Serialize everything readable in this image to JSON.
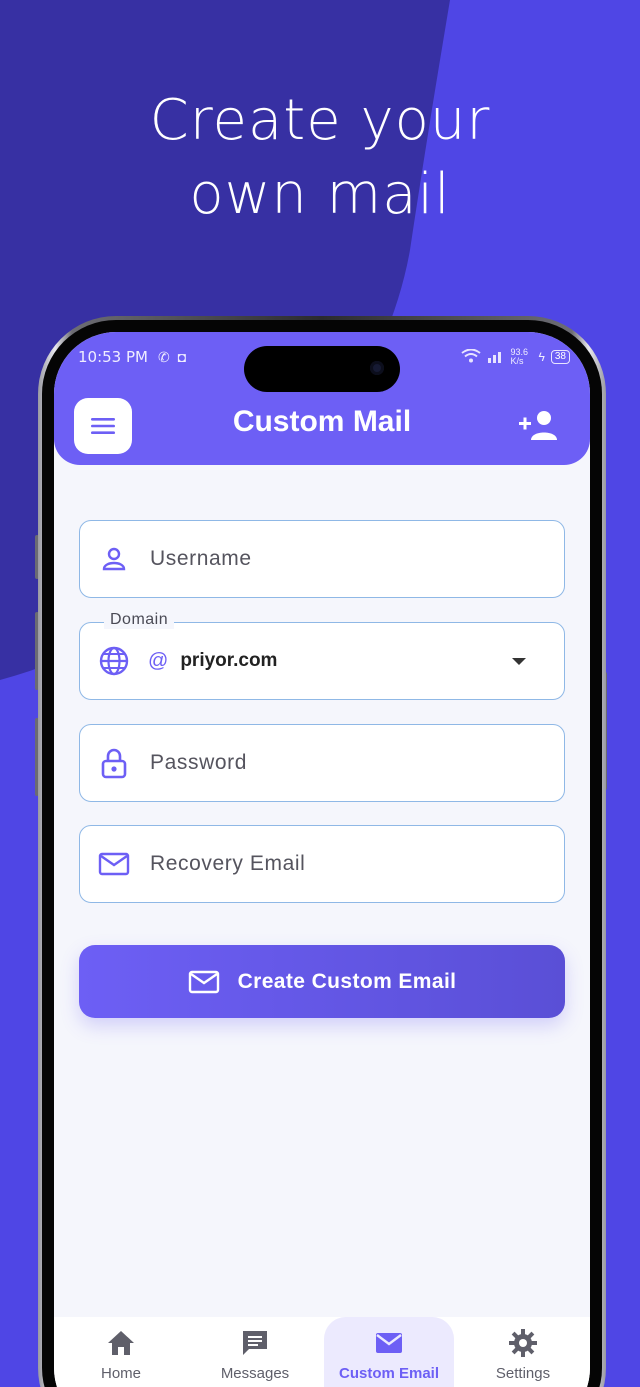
{
  "promo": {
    "line1": "Create your",
    "line2": "own mail"
  },
  "status_bar": {
    "time": "10:53 PM",
    "net_speed": "93.6 K/s",
    "battery": "38"
  },
  "app_bar": {
    "title": "Custom Mail",
    "menu_icon": "menu-icon",
    "action_icon": "add-user-icon"
  },
  "form": {
    "username": {
      "placeholder": "Username",
      "icon": "person-icon"
    },
    "domain": {
      "label": "Domain",
      "prefix": "@",
      "value": "priyor.com",
      "icon": "globe-icon"
    },
    "password": {
      "placeholder": "Password",
      "icon": "lock-icon"
    },
    "recovery_email": {
      "placeholder": "Recovery Email",
      "icon": "mail-icon"
    },
    "submit_label": "Create Custom Email"
  },
  "bottom_nav": {
    "items": [
      {
        "label": "Home",
        "icon": "home-icon"
      },
      {
        "label": "Messages",
        "icon": "message-icon"
      },
      {
        "label": "Custom Email",
        "icon": "mail-icon"
      },
      {
        "label": "Settings",
        "icon": "gear-icon"
      }
    ],
    "active": "Custom Email"
  },
  "colors": {
    "background": "#3730a3",
    "accent": "#6d5ff5",
    "field_border": "#8fb8e6"
  }
}
